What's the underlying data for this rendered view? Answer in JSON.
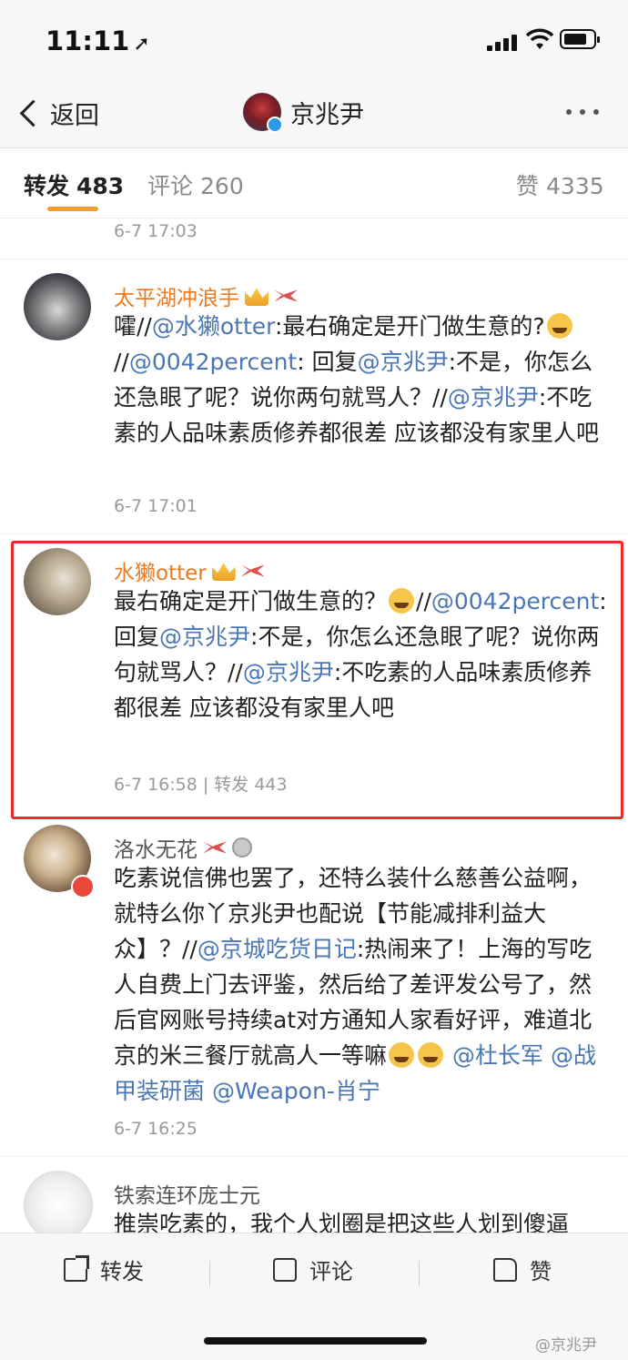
{
  "status": {
    "time": "11:11",
    "time_arrow": "➚"
  },
  "nav": {
    "back_label": "返回",
    "title": "京兆尹",
    "more_icon": "more-dots-icon"
  },
  "tabs": [
    {
      "label": "转发",
      "count": "483"
    },
    {
      "label": "评论",
      "count": "260"
    },
    {
      "label": "赞",
      "count": "4335"
    }
  ],
  "feed": {
    "top_time": "6-7 17:03",
    "items": [
      {
        "name": "太平湖冲浪手",
        "segments": [
          [
            "t",
            "嚯//"
          ],
          [
            "a",
            "@水獭otter"
          ],
          [
            "t",
            ":最右确定是开门做生意的?"
          ],
          [
            "e",
            ""
          ],
          [
            "t",
            "//"
          ],
          [
            "a",
            "@0042percent"
          ],
          [
            "t",
            ": 回复"
          ],
          [
            "a",
            "@京兆尹"
          ],
          [
            "t",
            ":不是，你怎么还急眼了呢？说你两句就骂人？//"
          ],
          [
            "a",
            "@京兆尹"
          ],
          [
            "t",
            ":不吃素的人品味素质修养都很差  应该都没有家里人吧"
          ]
        ],
        "time": "6-7 17:01"
      },
      {
        "name": "水獭otter",
        "segments": [
          [
            "t",
            "最右确定是开门做生意的？"
          ],
          [
            "e",
            ""
          ],
          [
            "t",
            "//"
          ],
          [
            "a",
            "@0042percent"
          ],
          [
            "t",
            ": 回复"
          ],
          [
            "a",
            "@京兆尹"
          ],
          [
            "t",
            ":不是，你怎么还急眼了呢？说你两句就骂人？//"
          ],
          [
            "a",
            "@京兆尹"
          ],
          [
            "t",
            ":不吃素的人品味素质修养都很差  应该都没有家里人吧"
          ]
        ],
        "time": "6-7 16:58 | 转发 443"
      },
      {
        "name": "洛水无花",
        "segments": [
          [
            "t",
            "吃素说信佛也罢了，还特么装什么慈善公益啊，就特么你丫京兆尹也配说【节能减排利益大众】？//"
          ],
          [
            "a",
            "@京城吃货日记"
          ],
          [
            "t",
            ":热闹来了！上海的写吃人自费上门去评鉴，然后给了差评发公号了，然后官网账号持续at对方通知人家看好评，难道北京的米三餐厅就高人一等嘛"
          ],
          [
            "e",
            ""
          ],
          [
            "e",
            ""
          ],
          [
            "t",
            " "
          ],
          [
            "a",
            "@杜长军"
          ],
          [
            "t",
            " "
          ],
          [
            "a",
            "@战甲装研菌"
          ],
          [
            "t",
            " "
          ],
          [
            "a",
            "@Weapon-肖宁"
          ]
        ],
        "time": "6-7 16:25"
      },
      {
        "name": "铁索连环庞士元",
        "segments": [
          [
            "t",
            "推崇吃素的，我个人划圈是把这些人划到傻逼"
          ]
        ],
        "time": ""
      }
    ]
  },
  "bottom": {
    "share": "转发",
    "comment": "评论",
    "like": "赞",
    "watermark": "@京兆尹"
  }
}
